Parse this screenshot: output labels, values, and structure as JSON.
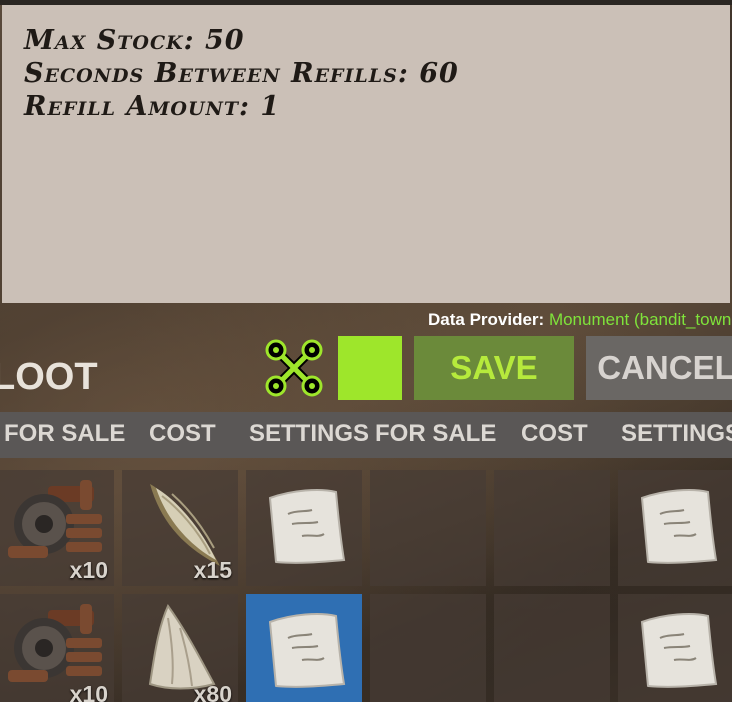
{
  "note": {
    "lines": [
      "Max Stock: 50",
      "Seconds Between Refills: 60",
      "Refill Amount: 1"
    ]
  },
  "provider": {
    "label": "Data Provider:",
    "value": "Monument (bandit_town"
  },
  "title": "LOOT",
  "toolbar": {
    "save_label": "SAVE",
    "cancel_label": "CANCEL",
    "color_swatch": "#9ee62b",
    "move_icon": "move-arrows-icon"
  },
  "columns": [
    "FOR SALE",
    "COST",
    "SETTINGS",
    "FOR SALE",
    "COST",
    "SETTINGS"
  ],
  "rows": [
    {
      "cells": [
        {
          "icon": "gears-icon",
          "qty": "x10"
        },
        {
          "icon": "corn-icon",
          "qty": "x15"
        },
        {
          "icon": "note-icon",
          "qty": ""
        },
        {
          "icon": "",
          "qty": ""
        },
        {
          "icon": "",
          "qty": ""
        },
        {
          "icon": "note-icon",
          "qty": ""
        }
      ]
    },
    {
      "cells": [
        {
          "icon": "gears-icon",
          "qty": "x10"
        },
        {
          "icon": "cloth-icon",
          "qty": "x80"
        },
        {
          "icon": "note-icon",
          "qty": "",
          "selected": true
        },
        {
          "icon": "",
          "qty": ""
        },
        {
          "icon": "",
          "qty": ""
        },
        {
          "icon": "note-icon",
          "qty": ""
        }
      ]
    }
  ]
}
